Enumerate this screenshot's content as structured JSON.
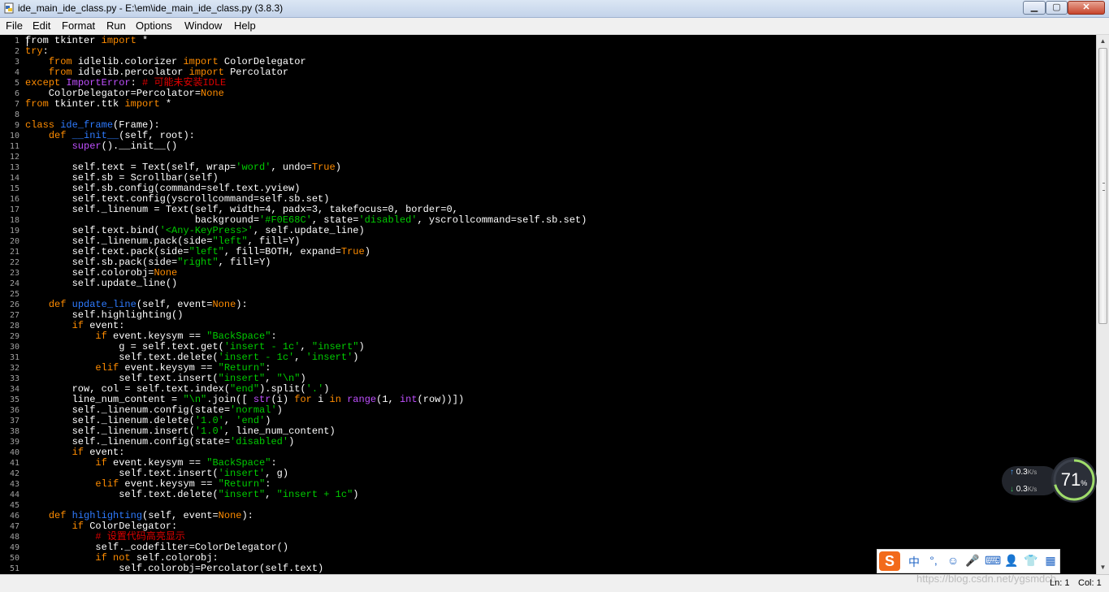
{
  "window": {
    "title": "ide_main_ide_class.py - E:\\em\\ide_main_ide_class.py (3.8.3)",
    "buttons": {
      "minimize": "▁",
      "maximize": "▢",
      "close": "✕"
    }
  },
  "menu": [
    "File",
    "Edit",
    "Format",
    "Run",
    "Options",
    "Window",
    "Help"
  ],
  "code_lines": [
    [
      [
        "",
        "from"
      ],
      [
        "",
        " tkinter "
      ],
      [
        "kw",
        "import"
      ],
      [
        "",
        " *"
      ]
    ],
    [
      [
        "kw",
        "try"
      ],
      [
        "",
        ":"
      ]
    ],
    [
      [
        "",
        "    "
      ],
      [
        "kw",
        "from"
      ],
      [
        "",
        " idlelib.colorizer "
      ],
      [
        "kw",
        "import"
      ],
      [
        "",
        " ColorDelegator"
      ]
    ],
    [
      [
        "",
        "    "
      ],
      [
        "kw",
        "from"
      ],
      [
        "",
        " idlelib.percolator "
      ],
      [
        "kw",
        "import"
      ],
      [
        "",
        " Percolator"
      ]
    ],
    [
      [
        "kw",
        "except"
      ],
      [
        "",
        " "
      ],
      [
        "bi",
        "ImportError"
      ],
      [
        "",
        ": "
      ],
      [
        "cm",
        "# 可能未安装IDLE"
      ]
    ],
    [
      [
        "",
        "    ColorDelegator=Percolator="
      ],
      [
        "kw",
        "None"
      ]
    ],
    [
      [
        "kw",
        "from"
      ],
      [
        "",
        " tkinter.ttk "
      ],
      [
        "kw",
        "import"
      ],
      [
        "",
        " *"
      ]
    ],
    [
      [
        "",
        ""
      ]
    ],
    [
      [
        "kw",
        "class"
      ],
      [
        "",
        " "
      ],
      [
        "def",
        "ide_frame"
      ],
      [
        "",
        "(Frame):"
      ]
    ],
    [
      [
        "",
        "    "
      ],
      [
        "kw",
        "def"
      ],
      [
        "",
        " "
      ],
      [
        "def",
        "__init__"
      ],
      [
        "",
        "(self, root):"
      ]
    ],
    [
      [
        "",
        "        "
      ],
      [
        "bi",
        "super"
      ],
      [
        "",
        "().__init__()"
      ]
    ],
    [
      [
        "",
        ""
      ]
    ],
    [
      [
        "",
        "        self.text = Text(self, wrap="
      ],
      [
        "str",
        "'word'"
      ],
      [
        "",
        ", undo="
      ],
      [
        "kw",
        "True"
      ],
      [
        "",
        ")"
      ]
    ],
    [
      [
        "",
        "        self.sb = Scrollbar(self)"
      ]
    ],
    [
      [
        "",
        "        self.sb.config(command=self.text.yview)"
      ]
    ],
    [
      [
        "",
        "        self.text.config(yscrollcommand=self.sb.set)"
      ]
    ],
    [
      [
        "",
        "        self._linenum = Text(self, width=4, padx=3, takefocus=0, border=0,"
      ]
    ],
    [
      [
        "",
        "                             background="
      ],
      [
        "str",
        "'#F0E68C'"
      ],
      [
        "",
        ", state="
      ],
      [
        "str",
        "'disabled'"
      ],
      [
        "",
        ", yscrollcommand=self.sb.set)"
      ]
    ],
    [
      [
        "",
        "        self.text.bind("
      ],
      [
        "str",
        "'<Any-KeyPress>'"
      ],
      [
        "",
        ", self.update_line)"
      ]
    ],
    [
      [
        "",
        "        self._linenum.pack(side="
      ],
      [
        "str",
        "\"left\""
      ],
      [
        "",
        ", fill=Y)"
      ]
    ],
    [
      [
        "",
        "        self.text.pack(side="
      ],
      [
        "str",
        "\"left\""
      ],
      [
        "",
        ", fill=BOTH, expand="
      ],
      [
        "kw",
        "True"
      ],
      [
        "",
        ")"
      ]
    ],
    [
      [
        "",
        "        self.sb.pack(side="
      ],
      [
        "str",
        "\"right\""
      ],
      [
        "",
        ", fill=Y)"
      ]
    ],
    [
      [
        "",
        "        self.colorobj="
      ],
      [
        "kw",
        "None"
      ]
    ],
    [
      [
        "",
        "        self.update_line()"
      ]
    ],
    [
      [
        "",
        ""
      ]
    ],
    [
      [
        "",
        "    "
      ],
      [
        "kw",
        "def"
      ],
      [
        "",
        " "
      ],
      [
        "def",
        "update_line"
      ],
      [
        "",
        "(self, event="
      ],
      [
        "kw",
        "None"
      ],
      [
        "",
        "):"
      ]
    ],
    [
      [
        "",
        "        self.highlighting()"
      ]
    ],
    [
      [
        "",
        "        "
      ],
      [
        "kw",
        "if"
      ],
      [
        "",
        " event:"
      ]
    ],
    [
      [
        "",
        "            "
      ],
      [
        "kw",
        "if"
      ],
      [
        "",
        " event.keysym == "
      ],
      [
        "str",
        "\"BackSpace\""
      ],
      [
        "",
        ":"
      ]
    ],
    [
      [
        "",
        "                g = self.text.get("
      ],
      [
        "str",
        "'insert - 1c'"
      ],
      [
        "",
        ", "
      ],
      [
        "str",
        "\"insert\""
      ],
      [
        "",
        ")"
      ]
    ],
    [
      [
        "",
        "                self.text.delete("
      ],
      [
        "str",
        "'insert - 1c'"
      ],
      [
        "",
        ", "
      ],
      [
        "str",
        "'insert'"
      ],
      [
        "",
        ")"
      ]
    ],
    [
      [
        "",
        "            "
      ],
      [
        "kw",
        "elif"
      ],
      [
        "",
        " event.keysym == "
      ],
      [
        "str",
        "\"Return\""
      ],
      [
        "",
        ":"
      ]
    ],
    [
      [
        "",
        "                self.text.insert("
      ],
      [
        "str",
        "\"insert\""
      ],
      [
        "",
        ", "
      ],
      [
        "str",
        "\"\\n\""
      ],
      [
        "",
        ")"
      ]
    ],
    [
      [
        "",
        "        row, col = self.text.index("
      ],
      [
        "str",
        "\"end\""
      ],
      [
        "",
        ").split("
      ],
      [
        "str",
        "'.'"
      ],
      [
        "",
        ")"
      ]
    ],
    [
      [
        "",
        "        line_num_content = "
      ],
      [
        "str",
        "\"\\n\""
      ],
      [
        "",
        ".join([ "
      ],
      [
        "bi",
        "str"
      ],
      [
        "",
        "(i) "
      ],
      [
        "kw",
        "for"
      ],
      [
        "",
        " i "
      ],
      [
        "kw",
        "in"
      ],
      [
        "",
        " "
      ],
      [
        "bi",
        "range"
      ],
      [
        "",
        "(1, "
      ],
      [
        "bi",
        "int"
      ],
      [
        "",
        "(row))])"
      ]
    ],
    [
      [
        "",
        "        self._linenum.config(state="
      ],
      [
        "str",
        "'normal'"
      ],
      [
        "",
        ")"
      ]
    ],
    [
      [
        "",
        "        self._linenum.delete("
      ],
      [
        "str",
        "'1.0'"
      ],
      [
        "",
        ", "
      ],
      [
        "str",
        "'end'"
      ],
      [
        "",
        ")"
      ]
    ],
    [
      [
        "",
        "        self._linenum.insert("
      ],
      [
        "str",
        "'1.0'"
      ],
      [
        "",
        ", line_num_content)"
      ]
    ],
    [
      [
        "",
        "        self._linenum.config(state="
      ],
      [
        "str",
        "'disabled'"
      ],
      [
        "",
        ")"
      ]
    ],
    [
      [
        "",
        "        "
      ],
      [
        "kw",
        "if"
      ],
      [
        "",
        " event:"
      ]
    ],
    [
      [
        "",
        "            "
      ],
      [
        "kw",
        "if"
      ],
      [
        "",
        " event.keysym == "
      ],
      [
        "str",
        "\"BackSpace\""
      ],
      [
        "",
        ":"
      ]
    ],
    [
      [
        "",
        "                self.text.insert("
      ],
      [
        "str",
        "'insert'"
      ],
      [
        "",
        ", g)"
      ]
    ],
    [
      [
        "",
        "            "
      ],
      [
        "kw",
        "elif"
      ],
      [
        "",
        " event.keysym == "
      ],
      [
        "str",
        "\"Return\""
      ],
      [
        "",
        ":"
      ]
    ],
    [
      [
        "",
        "                self.text.delete("
      ],
      [
        "str",
        "\"insert\""
      ],
      [
        "",
        ", "
      ],
      [
        "str",
        "\"insert + 1c\""
      ],
      [
        "",
        ")"
      ]
    ],
    [
      [
        "",
        ""
      ]
    ],
    [
      [
        "",
        "    "
      ],
      [
        "kw",
        "def"
      ],
      [
        "",
        " "
      ],
      [
        "def",
        "highlighting"
      ],
      [
        "",
        "(self, event="
      ],
      [
        "kw",
        "None"
      ],
      [
        "",
        "):"
      ]
    ],
    [
      [
        "",
        "        "
      ],
      [
        "kw",
        "if"
      ],
      [
        "",
        " ColorDelegator:"
      ]
    ],
    [
      [
        "",
        "            "
      ],
      [
        "cm",
        "# 设置代码高亮显示"
      ]
    ],
    [
      [
        "",
        "            self._codefilter=ColorDelegator()"
      ]
    ],
    [
      [
        "",
        "            "
      ],
      [
        "kw",
        "if not"
      ],
      [
        "",
        " self.colorobj:"
      ]
    ],
    [
      [
        "",
        "                self.colorobj=Percolator(self.text)"
      ]
    ]
  ],
  "status": {
    "watermark": "https://blog.csdn.net/ygsmdcb",
    "line": "Ln: 1",
    "col": "Col: 1"
  },
  "net": {
    "up": "0.3",
    "down": "0.3",
    "unit": "K/s",
    "percent": "71",
    "percent_sym": "%",
    "percent_value": 71
  },
  "ime": {
    "logo": "S",
    "mode": "中",
    "icons": [
      "°,",
      "☺",
      "🎤",
      "⌨",
      "👤",
      "👕",
      "▦"
    ]
  }
}
